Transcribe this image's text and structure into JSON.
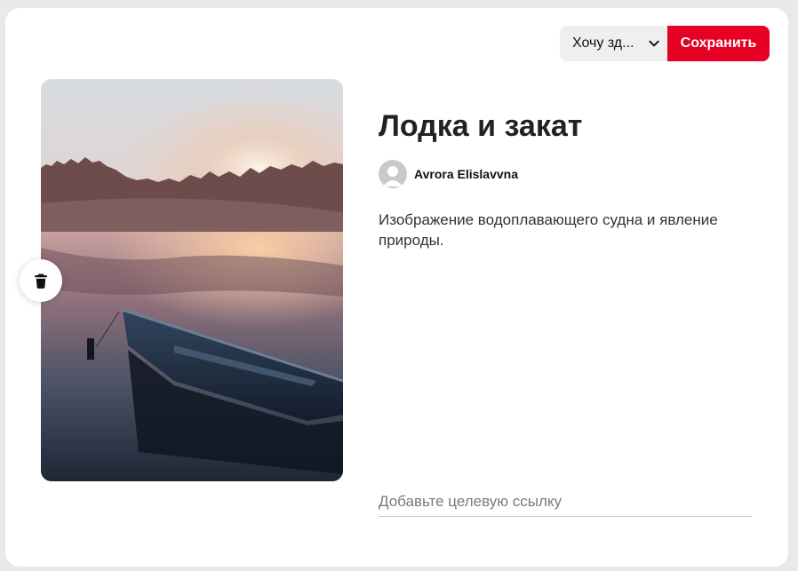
{
  "toolbar": {
    "board_select_label": "Хочу зд...",
    "save_label": "Сохранить"
  },
  "pin": {
    "title": "Лодка и закат",
    "author": "Avrora Elislavvna",
    "description": "Изображение водоплавающего судна и явление природы.",
    "link_placeholder": "Добавьте целевую ссылку",
    "image_subject": "boat-at-sunset-photo"
  },
  "icons": {
    "chevron": "chevron-down-icon",
    "trash": "trash-icon",
    "avatar": "default-avatar-icon"
  },
  "colors": {
    "save_button": "#e60023",
    "select_background": "#efefef",
    "card_background": "#ffffff",
    "page_background": "#e9e9e9"
  }
}
